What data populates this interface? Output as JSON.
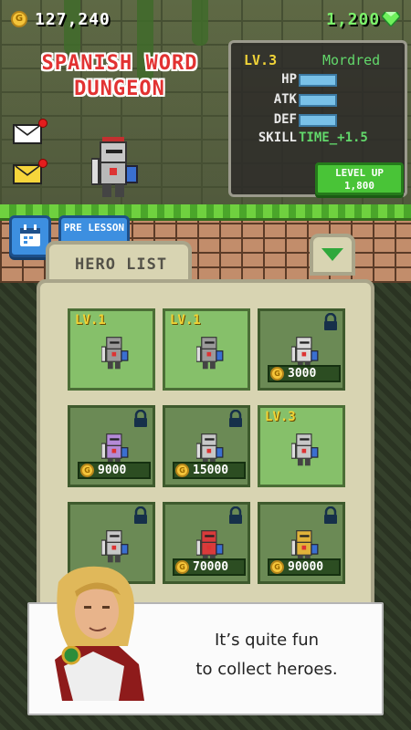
{
  "currency": {
    "gold": "127,240",
    "gems": "1,200",
    "coin_icon": "G"
  },
  "game_title": {
    "line1": "SPANISH WORD",
    "line2": "DUNGEON"
  },
  "hero_stats": {
    "level": "LV.3",
    "name": "Mordred",
    "hp_label": "HP",
    "atk_label": "ATK",
    "def_label": "DEF",
    "skill_label": "SKILL",
    "skill_value": "TIME_+1.5"
  },
  "level_up": {
    "label": "LEVEL UP",
    "cost": "1,800"
  },
  "buttons": {
    "pre_lesson": "PRE LESSON"
  },
  "hero_list": {
    "tab_label": "HERO LIST"
  },
  "heroes": [
    {
      "level": "LV.1",
      "price": "",
      "locked": false,
      "color": "#9b9a9a"
    },
    {
      "level": "LV.1",
      "price": "",
      "locked": false,
      "color": "#9b9a9a"
    },
    {
      "level": "",
      "price": "3000",
      "locked": true,
      "color": "#d9d9d9"
    },
    {
      "level": "",
      "price": "9000",
      "locked": true,
      "color": "#b48ad6"
    },
    {
      "level": "",
      "price": "15000",
      "locked": true,
      "color": "#c7c7c7"
    },
    {
      "level": "LV.3",
      "price": "",
      "locked": false,
      "color": "#c7c7c7"
    },
    {
      "level": "",
      "price": "",
      "locked": true,
      "color": "#c7c7c7"
    },
    {
      "level": "",
      "price": "70000",
      "locked": true,
      "color": "#d93b3b"
    },
    {
      "level": "",
      "price": "90000",
      "locked": true,
      "color": "#e0b23a"
    }
  ],
  "dialog": {
    "line1": "It’s quite fun",
    "line2": "to collect heroes."
  },
  "colors": {
    "gold": "#f5c53a",
    "gem": "#6ff05c",
    "title_red": "#e23232",
    "level_yellow": "#f0d338",
    "stat_bar": "#79c1e8",
    "card_green": "#86c06a",
    "button_blue": "#3d8fe0",
    "levelup_green": "#49c437"
  }
}
